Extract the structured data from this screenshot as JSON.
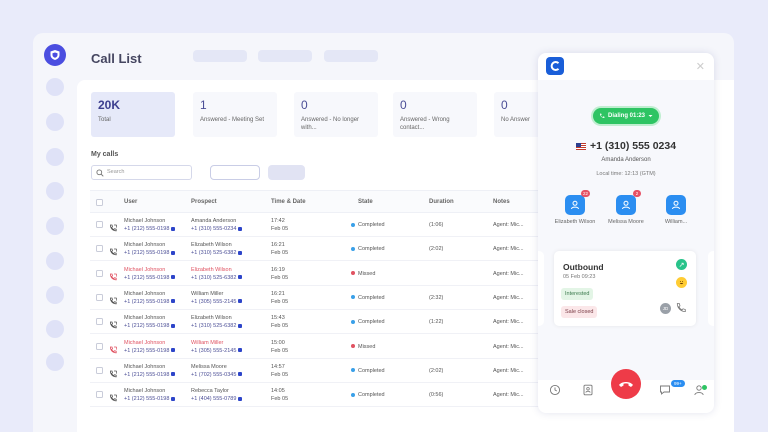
{
  "page_title": "Call List",
  "stats": [
    {
      "value": "20K",
      "label": "Total"
    },
    {
      "value": "1",
      "label": "Answered - Meeting Set"
    },
    {
      "value": "0",
      "label": "Answered - No longer with..."
    },
    {
      "value": "0",
      "label": "Answered - Wrong contact..."
    },
    {
      "value": "0",
      "label": "No Answer"
    }
  ],
  "section_title": "My calls",
  "search": {
    "placeholder": "Search"
  },
  "table": {
    "headers": {
      "user": "User",
      "prospect": "Prospect",
      "time_date": "Time & Date",
      "state": "State",
      "duration": "Duration",
      "notes": "Notes"
    },
    "rows": [
      {
        "user": "Michael Johnson",
        "user_phone": "+1 (212) 555-0198",
        "prospect": "Amanda Anderson",
        "prospect_phone": "+1 (310) 555-0234",
        "time": "17:42",
        "date": "Feb 05",
        "state": "Completed",
        "duration": "(1:06)",
        "notes": "Agent: Mic..."
      },
      {
        "user": "Michael Johnson",
        "user_phone": "+1 (212) 555-0198",
        "prospect": "Elizabeth Wilson",
        "prospect_phone": "+1 (310) 525-6382",
        "time": "16:21",
        "date": "Feb 05",
        "state": "Completed",
        "duration": "(2:02)",
        "notes": "Agent: Mic..."
      },
      {
        "user": "Michael Johnson",
        "user_phone": "+1 (212) 555-0198",
        "prospect": "Elizabeth Wilson",
        "prospect_phone": "+1 (310) 525-6382",
        "time": "16:19",
        "date": "Feb 05",
        "state": "Missed",
        "duration": "",
        "notes": "Agent: Mic..."
      },
      {
        "user": "Michael Johnson",
        "user_phone": "+1 (212) 555-0198",
        "prospect": "William Miller",
        "prospect_phone": "+1 (305) 555-2145",
        "time": "16:21",
        "date": "Feb 05",
        "state": "Completed",
        "duration": "(2:32)",
        "notes": "Agent: Mic..."
      },
      {
        "user": "Michael Johnson",
        "user_phone": "+1 (212) 555-0198",
        "prospect": "Elizabeth Wilson",
        "prospect_phone": "+1 (310) 525-6382",
        "time": "15:43",
        "date": "Feb 05",
        "state": "Completed",
        "duration": "(1:22)",
        "notes": "Agent: Mic..."
      },
      {
        "user": "Michael Johnson",
        "user_phone": "+1 (212) 555-0198",
        "prospect": "William Miller",
        "prospect_phone": "+1 (305) 555-2145",
        "time": "15:00",
        "date": "Feb 05",
        "state": "Missed",
        "duration": "",
        "notes": "Agent: Mic..."
      },
      {
        "user": "Michael Johnson",
        "user_phone": "+1 (212) 555-0198",
        "prospect": "Melissa Moore",
        "prospect_phone": "+1 (702) 555-0345",
        "time": "14:57",
        "date": "Feb 05",
        "state": "Completed",
        "duration": "(2:02)",
        "notes": "Agent: Mic..."
      },
      {
        "user": "Michael Johnson",
        "user_phone": "+1 (212) 555-0198",
        "prospect": "Rebecca Taylor",
        "prospect_phone": "+1 (404) 555-0789",
        "time": "14:05",
        "date": "Feb 05",
        "state": "Completed",
        "duration": "(0:56)",
        "notes": "Agent: Mic..."
      }
    ]
  },
  "dialer": {
    "status": "Dialing 01:23",
    "number": "+1 (310) 555 0234",
    "contact_name": "Amanda Anderson",
    "local_time": "Local time: 12:13 (GTM)",
    "transfer_contacts": [
      {
        "name": "Elizabeth Wilson",
        "badge": "22"
      },
      {
        "name": "Melissa Moore",
        "badge": "2"
      },
      {
        "name": "William...",
        "badge": ""
      }
    ],
    "card": {
      "title": "Outbound",
      "date": "05 Feb 09:23",
      "tags": [
        "Interested",
        "Sale closed"
      ],
      "initials": "JD"
    },
    "messages_badge": "99+"
  },
  "colors": {
    "accent": "#4b4ee0",
    "completed": "#3aa0e8",
    "missed": "#e05261",
    "dialing": "#2ec463",
    "hangup": "#ee3b48"
  }
}
